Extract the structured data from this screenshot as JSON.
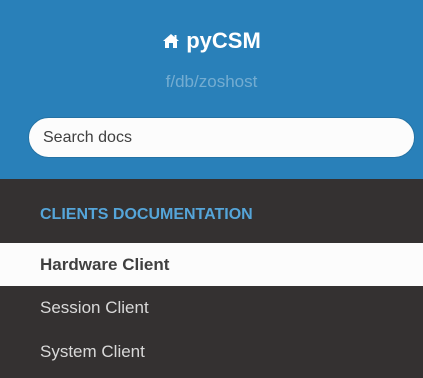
{
  "header": {
    "project_name": "pyCSM",
    "version": "f/db/zoshost",
    "home_icon": "home-icon",
    "search_placeholder": "Search docs"
  },
  "nav": {
    "caption": "CLIENTS DOCUMENTATION",
    "items": [
      {
        "label": "Hardware Client",
        "current": true
      },
      {
        "label": "Session Client",
        "current": false
      },
      {
        "label": "System Client",
        "current": false
      }
    ]
  },
  "colors": {
    "header_bg": "#2980b9",
    "sidebar_bg": "#343131",
    "caption": "#55a5d9",
    "current_item_bg": "#fcfcfc"
  }
}
